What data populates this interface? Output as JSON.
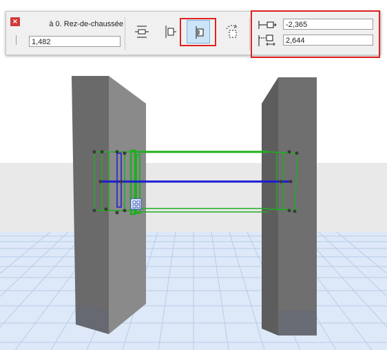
{
  "toolbar": {
    "close_icon": "close-icon",
    "story_label": "à 0. Rez-de-chaussée",
    "elevation_value": "1,482",
    "tools": [
      {
        "name": "anchor-toggle-icon",
        "active": false
      },
      {
        "name": "align-left-icon",
        "active": false
      },
      {
        "name": "align-center-icon",
        "active": true
      },
      {
        "name": "rotate-reference-icon",
        "active": false
      }
    ],
    "offset_icon": "horizontal-offset-icon",
    "offset_value": "-2,365",
    "depth_icon": "vertical-offset-icon",
    "depth_value": "2,644",
    "highlight_color": "#e02020"
  },
  "viewport": {
    "floor_color": "#dde9f8",
    "sky_color": "#e9e9e9",
    "wall_color": "#6d6d6d",
    "selection_color": "#1fae1f",
    "reference_line_color": "#1a1ad4",
    "handle_icon": "grid-handle-icon"
  }
}
